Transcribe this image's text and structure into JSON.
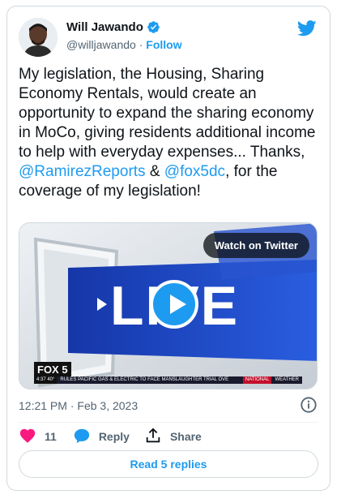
{
  "author": {
    "name": "Will Jawando",
    "handle": "@willjawando",
    "separator": "·",
    "follow_label": "Follow",
    "verified": true
  },
  "tweet": {
    "text_before": "My legislation, the Housing, Sharing Economy Rentals, would create an opportunity to expand the sharing economy in MoCo, giving residents additional income to help with everyday expenses... Thanks, ",
    "mention1": "@RamirezReports",
    "text_middle": " & ",
    "mention2": "@fox5dc",
    "text_after": ", for the coverage of my legislation!"
  },
  "media": {
    "watch_label": "Watch on Twitter",
    "big_text": "LIVE",
    "channel_logo": "FOX 5",
    "ticker_time": "4:37  40°",
    "ticker_headline": "RULES PACIFIC GAS & ELECTRIC TO FACE MANSLAUGHTER TRIAL OVE",
    "ticker_national": "NATIONAL",
    "ticker_weather": "WEATHER"
  },
  "timestamp": {
    "time": "12:21 PM",
    "separator": "·",
    "date": "Feb 3, 2023"
  },
  "actions": {
    "like_count": "11",
    "reply_label": "Reply",
    "share_label": "Share"
  },
  "read_replies_label": "Read 5 replies",
  "colors": {
    "brand": "#1d9bf0",
    "like": "#f91880",
    "text": "#0f1419",
    "muted": "#536471"
  }
}
